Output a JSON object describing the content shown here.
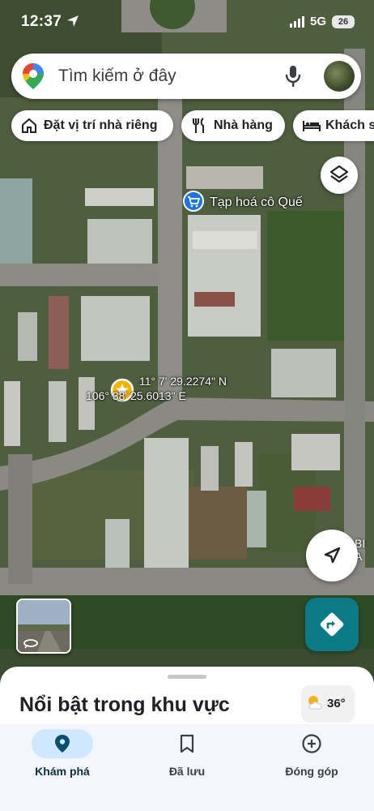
{
  "status_bar": {
    "time": "12:37",
    "network": "5G",
    "battery": "26"
  },
  "search": {
    "placeholder": "Tìm kiếm ở đây"
  },
  "chips": [
    {
      "label": "Đặt vị trí nhà riêng",
      "icon": "home-icon"
    },
    {
      "label": "Nhà hàng",
      "icon": "restaurant-icon"
    },
    {
      "label": "Khách s",
      "icon": "hotel-icon"
    }
  ],
  "map": {
    "place_label": "Tạp hoá cô Quế",
    "pin": {
      "lat": "11° 7' 29.2274\" N",
      "lng": "106° 38' 25.6013\" E"
    },
    "edge_label": "BI A"
  },
  "bottom_sheet": {
    "title": "Nổi bật trong khu vực",
    "weather_temp": "36°"
  },
  "nav": [
    {
      "label": "Khám phá",
      "icon": "explore-pin-icon",
      "active": true
    },
    {
      "label": "Đã lưu",
      "icon": "bookmark-icon",
      "active": false
    },
    {
      "label": "Đóng góp",
      "icon": "add-circle-icon",
      "active": false
    }
  ],
  "colors": {
    "accent": "#0b7a87",
    "active_pill": "#cfe8ff",
    "star": "#f4b400"
  }
}
